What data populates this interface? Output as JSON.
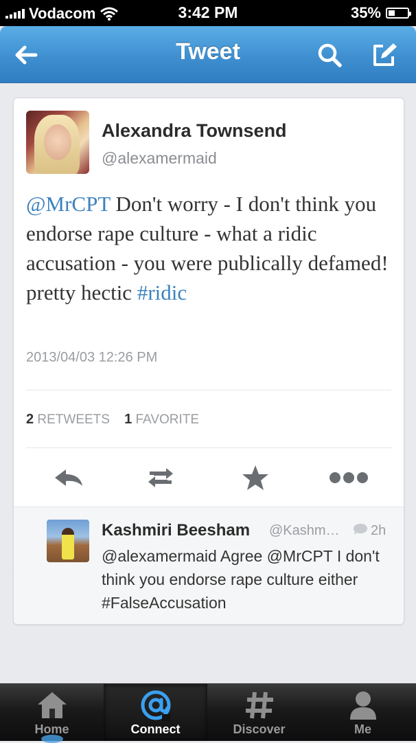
{
  "status_bar": {
    "carrier": "Vodacom",
    "time": "3:42 PM",
    "battery_text": "35%",
    "battery_level": 0.35
  },
  "nav": {
    "title": "Tweet",
    "back_icon": "arrow-left-icon",
    "search_icon": "search-icon",
    "compose_icon": "compose-icon"
  },
  "tweet": {
    "author_name": "Alexandra Townsend",
    "author_handle": "@alexamermaid",
    "text_mention": "@MrCPT",
    "text_body": " Don't worry - I don't think you endorse rape culture - what a ridic accusation - you were publically defamed! pretty hectic ",
    "text_hashtag": "#ridic",
    "timestamp": "2013/04/03 12:26 PM",
    "retweets_count": "2",
    "retweets_label": "RETWEETS",
    "favorites_count": "1",
    "favorites_label": "FAVORITE",
    "actions": [
      "reply-icon",
      "retweet-icon",
      "favorite-star-icon",
      "more-icon"
    ]
  },
  "reply": {
    "name": "Kashmiri Beesham",
    "handle": "@Kashm…",
    "time": "2h",
    "text": "@alexamermaid Agree @MrCPT I don't think you endorse rape culture either #FalseAccusation"
  },
  "tabbar": {
    "tabs": [
      {
        "label": "Home",
        "icon": "home-icon"
      },
      {
        "label": "Connect",
        "icon": "at-icon"
      },
      {
        "label": "Discover",
        "icon": "hash-icon"
      },
      {
        "label": "Me",
        "icon": "person-icon"
      }
    ],
    "active": "Connect"
  },
  "colors": {
    "nav_blue": "#3f8fd0",
    "link_blue": "#3b82be",
    "connect_blue": "#3aa0f0"
  }
}
